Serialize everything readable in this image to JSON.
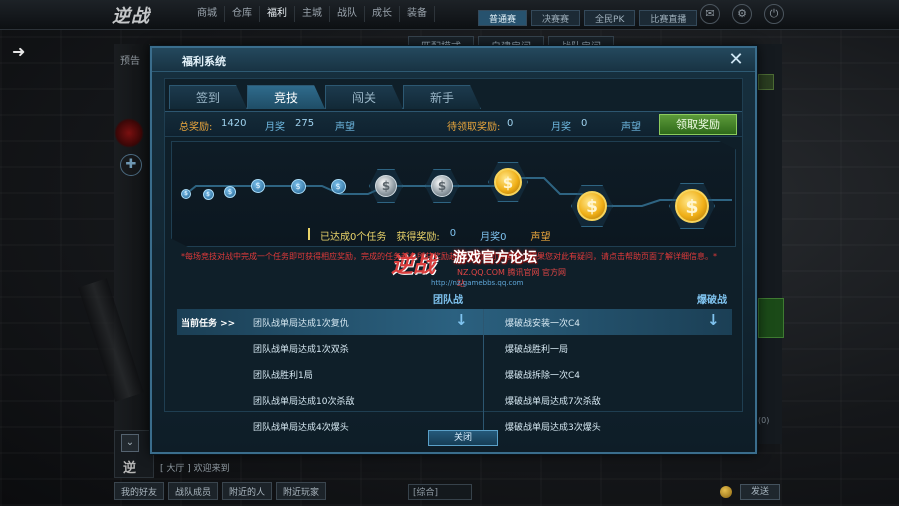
{
  "background": {
    "top_logo": "逆战",
    "top_nav": [
      "商城",
      "仓库",
      "福利",
      "主城",
      "战队",
      "成长",
      "装备"
    ],
    "top_tabs": [
      "普通赛",
      "决赛赛",
      "全民PK",
      "比赛直播"
    ],
    "side_label": "预告",
    "right_tabs": [
      "匹配模式",
      "自建房间",
      "战队房间"
    ],
    "bottom_buttons": [
      "我的好友",
      "战队成员",
      "附近的人",
      "附近玩家"
    ],
    "bottom_count": "(0)",
    "bottom_left_text": "逆",
    "bottom_mid_text": "[ 大厅 ] 欢迎来到",
    "chat_channel": "[综合]",
    "send_label": "发送"
  },
  "dialog": {
    "title": "福利系统",
    "close_icon": "✕",
    "tabs": [
      {
        "label": "签到",
        "active": false
      },
      {
        "label": "竞技",
        "active": true
      },
      {
        "label": "闯关",
        "active": false
      },
      {
        "label": "新手",
        "active": false
      }
    ],
    "info": {
      "total_reward_label": "总奖励:",
      "total_reward_value": "1420",
      "monthly_label": "月奖",
      "monthly_value": "275",
      "prestige_label": "声望",
      "pending_label": "待领取奖励:",
      "pending_value": "0",
      "pending_monthly_label": "月奖",
      "pending_monthly_value": "0",
      "pending_prestige_label": "声望",
      "claim_button": "领取奖励"
    },
    "progress": {
      "nodes": [
        {
          "tier": "small",
          "symbol": "$"
        },
        {
          "tier": "small",
          "symbol": "$"
        },
        {
          "tier": "small",
          "symbol": "$"
        },
        {
          "tier": "small",
          "symbol": "$"
        },
        {
          "tier": "small",
          "symbol": "$"
        },
        {
          "tier": "small",
          "symbol": "$"
        },
        {
          "tier": "silver",
          "symbol": "$"
        },
        {
          "tier": "silver",
          "symbol": "$"
        },
        {
          "tier": "gold",
          "symbol": "$"
        },
        {
          "tier": "gold",
          "symbol": "$"
        },
        {
          "tier": "gold",
          "symbol": "$"
        }
      ],
      "completed_text": "已达成0个任务",
      "earned_label": "获得奖励:",
      "earned_value": "0",
      "monthly_text": "月奖0",
      "prestige_text": "声望"
    },
    "note": "*每场竞技对战中完成一个任务即可获得相应奖励，完成的任务越多所获奖励越多，奖励可以累计，如果您对此有疑问，请点击帮助页面了解详细信息。*",
    "watermark": {
      "logo": "逆战",
      "title": "游戏官方论坛",
      "subtitle": "NZ.QQ.COM 腾讯官网 官方网站",
      "url": "http://nz.gamebbs.qq.com"
    },
    "columns": {
      "team": "团队战",
      "bomb": "爆破战"
    },
    "current_task_label": "当前任务 >>",
    "team_tasks": [
      "团队战单局达成1次复仇",
      "团队战单局达成1次双杀",
      "团队战胜利1局",
      "团队战单局达成10次杀敌",
      "团队战单局达成4次爆头"
    ],
    "bomb_tasks": [
      "爆破战安装一次C4",
      "爆破战胜利一局",
      "爆破战拆除一次C4",
      "爆破战单局达成7次杀敌",
      "爆破战单局达成3次爆头"
    ],
    "close_button": "关闭"
  },
  "colors": {
    "accent_blue": "#7fc3ef",
    "label_orange": "#e8a53c",
    "claim_green": "#4a8a2c",
    "note_red": "#e03a3a",
    "gold": "#f0b018"
  }
}
